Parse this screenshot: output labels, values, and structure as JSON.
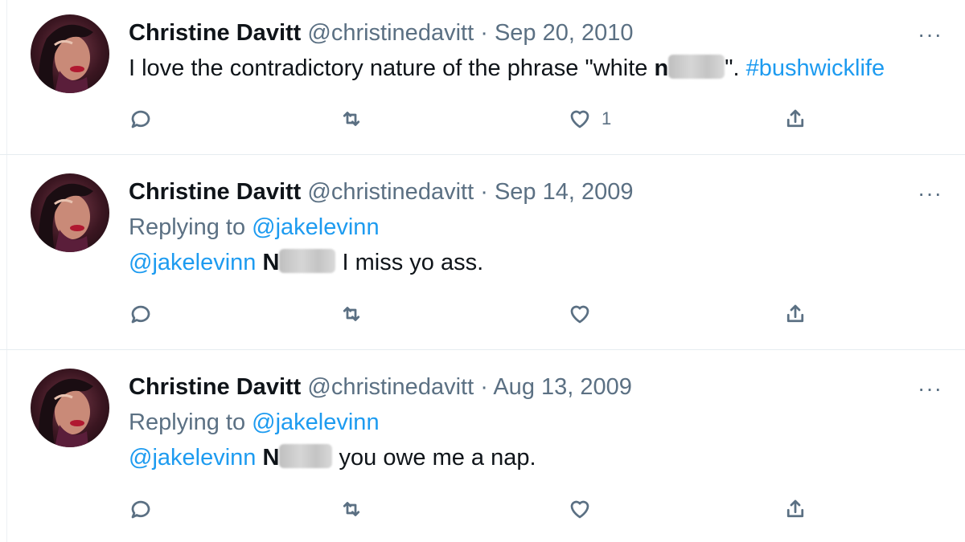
{
  "tweets": [
    {
      "author_name": "Christine Davitt",
      "handle": "@christinedavitt",
      "separator": "·",
      "date": "Sep 20, 2010",
      "more": "···",
      "body_pre": "I love the contradictory nature of the phrase \"white ",
      "body_redacted_initial": "n",
      "body_post": "\". ",
      "hashtag": "#bushwicklife",
      "like_count": "1"
    },
    {
      "author_name": "Christine Davitt",
      "handle": "@christinedavitt",
      "separator": "·",
      "date": "Sep 14, 2009",
      "more": "···",
      "replying_prefix": "Replying to ",
      "replying_to": "@jakelevinn",
      "mention": "@jakelevinn",
      "body_redacted_initial": "N",
      "body_post": "I miss yo ass."
    },
    {
      "author_name": "Christine Davitt",
      "handle": "@christinedavitt",
      "separator": "·",
      "date": "Aug 13, 2009",
      "more": "···",
      "replying_prefix": "Replying to ",
      "replying_to": "@jakelevinn",
      "mention": "@jakelevinn",
      "body_redacted_initial": "N",
      "body_post": "you owe me a nap."
    }
  ],
  "icons": {
    "reply": "reply-icon",
    "retweet": "retweet-icon",
    "like": "heart-icon",
    "share": "share-icon",
    "more": "more-icon"
  },
  "colors": {
    "link": "#1d9bf0",
    "muted": "#5b7083",
    "text": "#0f1419"
  }
}
